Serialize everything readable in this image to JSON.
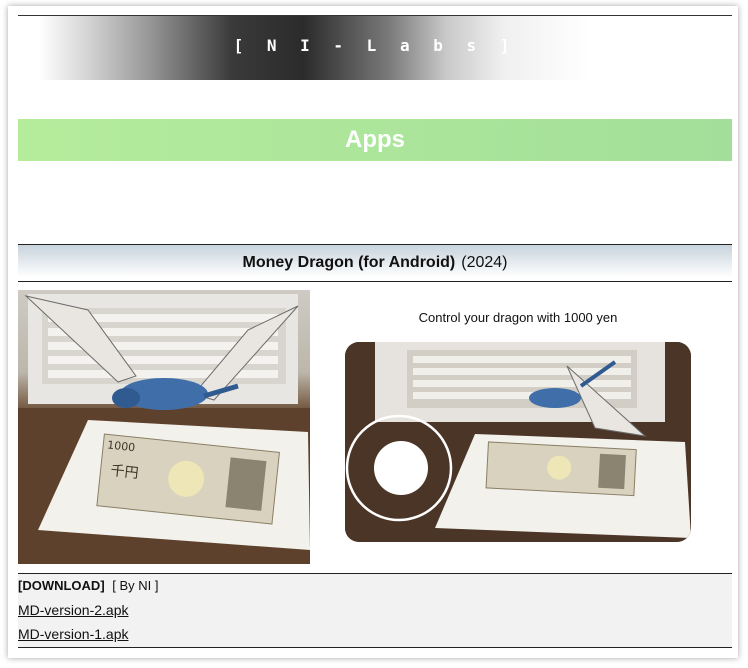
{
  "header": {
    "site_title": "[ N I - L a b s ]"
  },
  "section": {
    "title": "Apps"
  },
  "app": {
    "name": "Money Dragon (for Android)",
    "year": "(2024)",
    "caption": "Control your dragon with 1000 yen"
  },
  "download": {
    "label": "[DOWNLOAD]",
    "by": "[ By NI ]",
    "links": [
      "MD-version-2.apk",
      "MD-version-1.apk"
    ]
  },
  "banknote": {
    "denomination": "1000",
    "kanji": "千円"
  },
  "colors": {
    "banner_green": "#b5ec9c",
    "header_dark": "#2b2b2b",
    "dragon_blue": "#3f6ea8"
  },
  "icons": {
    "left_photo": "dragon-ar-photo",
    "right_photo": "dragon-ar-screenshot",
    "joystick": "virtual-joystick-icon"
  }
}
